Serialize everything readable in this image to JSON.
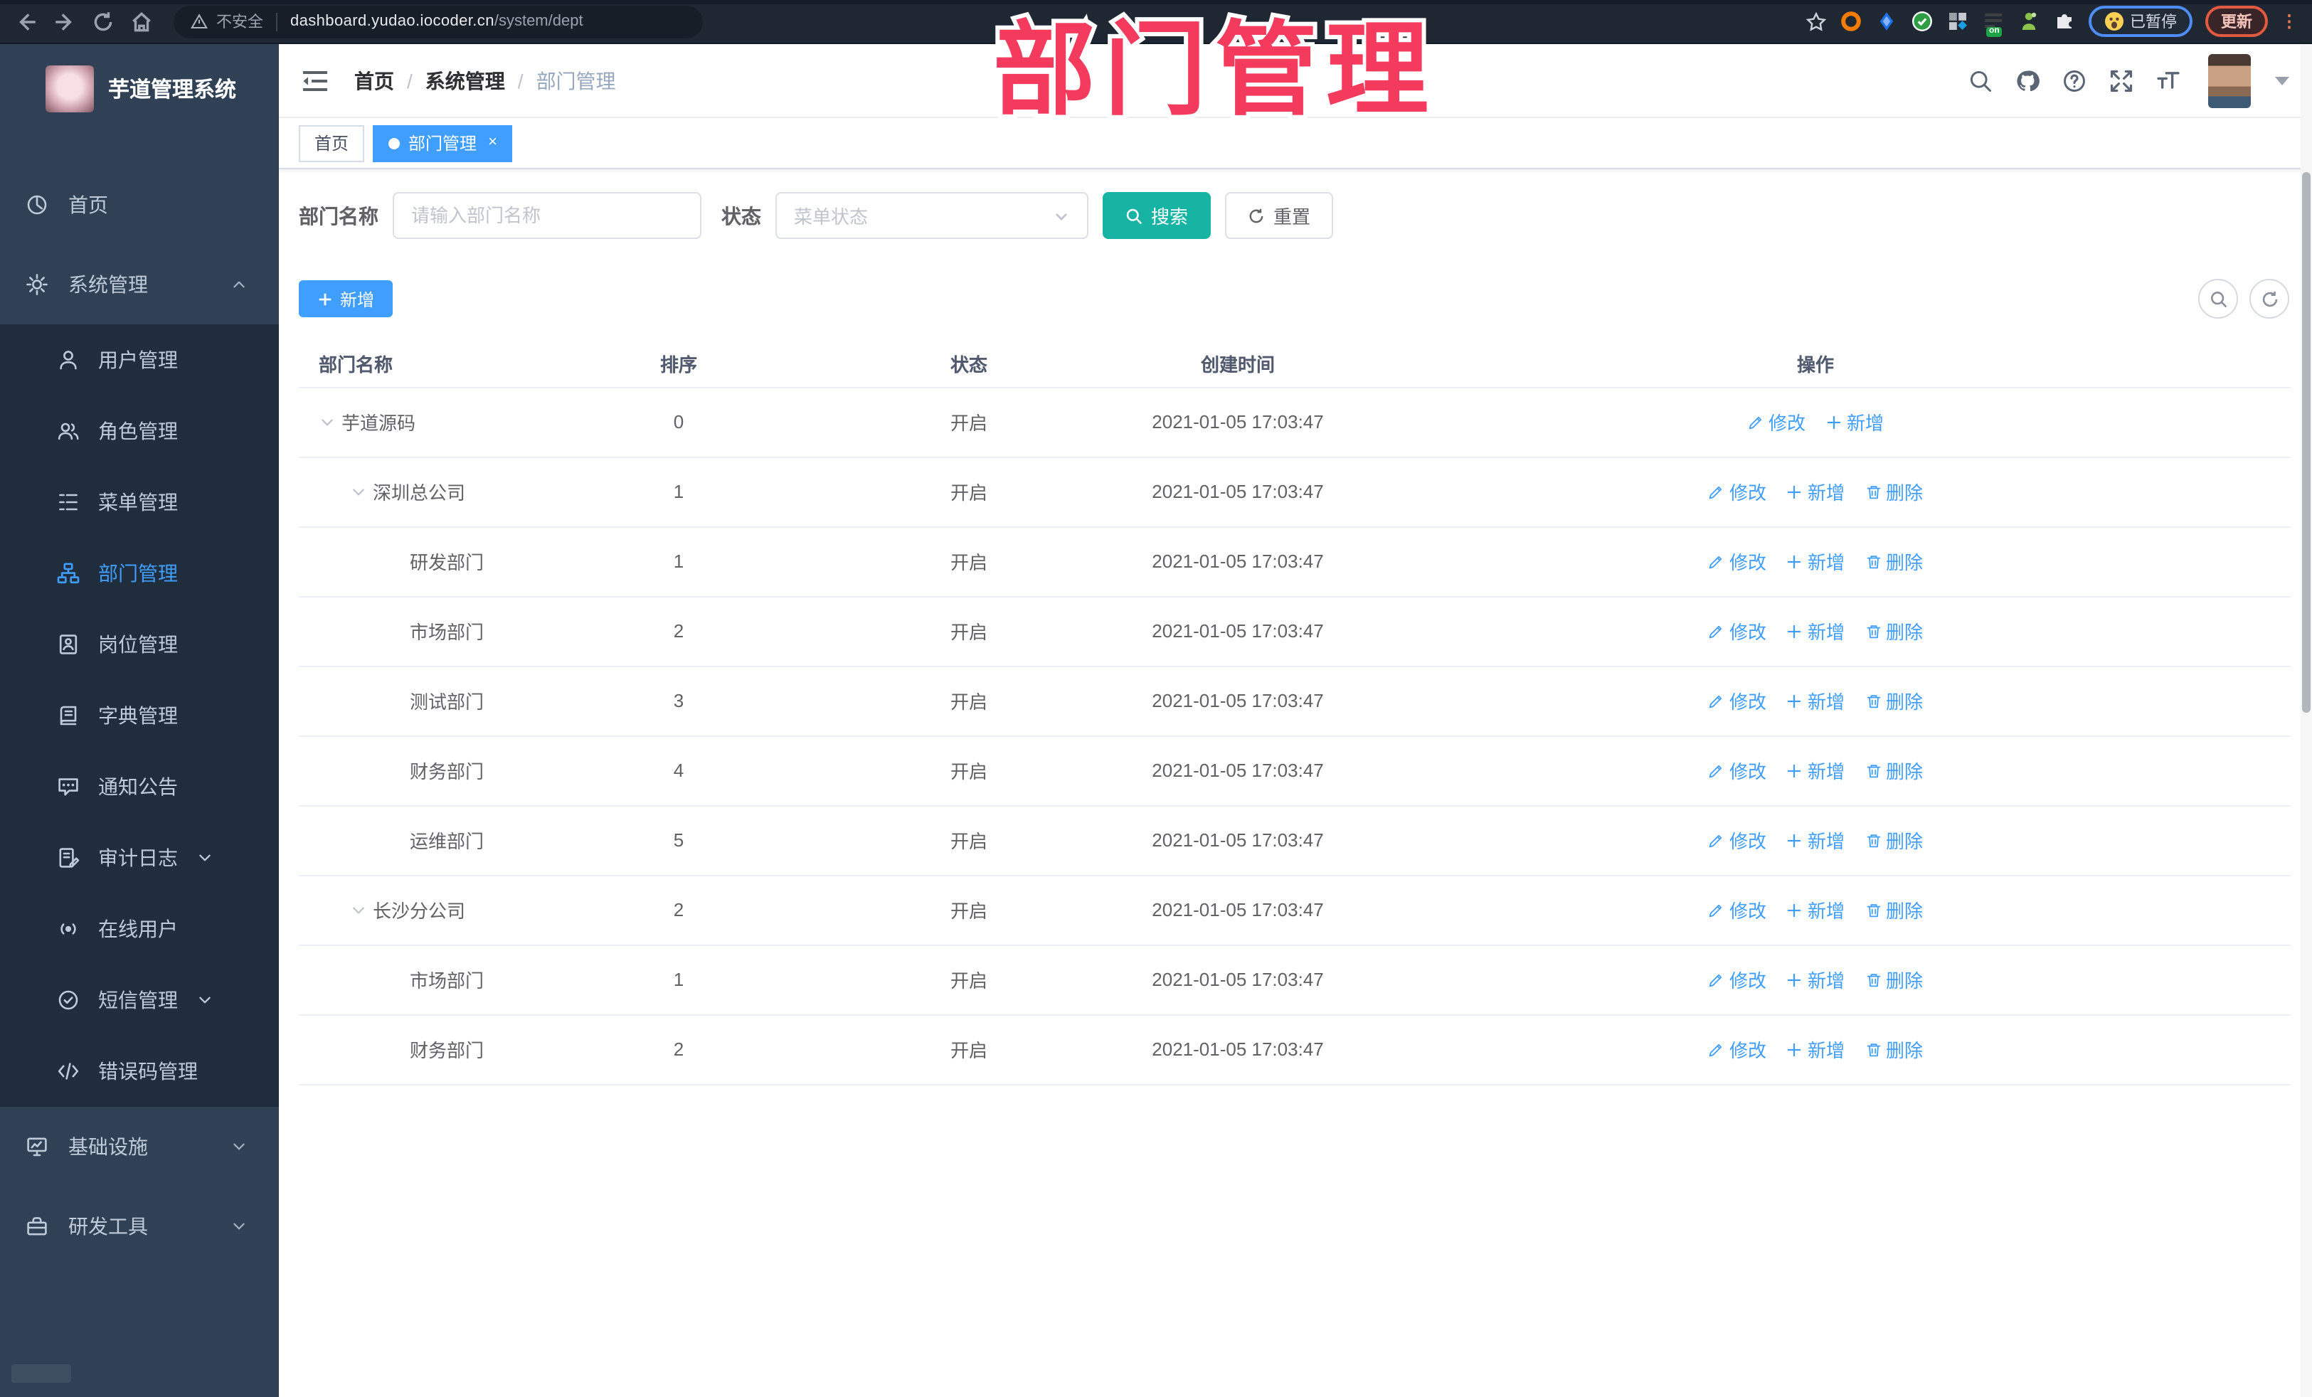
{
  "watermark": "部门管理",
  "colors": {
    "accent": "#409eff",
    "search_button": "#17b3a3",
    "watermark": "#f43b5e",
    "sidebar_bg": "#304156",
    "submenu_bg": "#1f2d3d",
    "active_tab": "#409eff"
  },
  "browser": {
    "security_label": "不安全",
    "url_host": "dashboard.yudao.iocoder.cn",
    "url_path": "/system/dept",
    "paused_label": "已暂停",
    "update_label": "更新",
    "extension_on_badge": "on",
    "extensions": [
      "orange-ring-extension-icon",
      "blue-drop-extension-icon",
      "green-check-extension-icon",
      "grid-extension-icon",
      "list-on-extension-icon",
      "green-person-extension-icon",
      "puzzle-extension-icon"
    ]
  },
  "sidebar": {
    "app_title": "芋道管理系统",
    "items": [
      {
        "id": "home",
        "label": "首页",
        "icon": "dashboard-icon",
        "level": "top"
      },
      {
        "id": "system",
        "label": "系统管理",
        "icon": "gear-icon",
        "level": "top",
        "arrow": "up"
      },
      {
        "id": "user",
        "label": "用户管理",
        "icon": "user-icon",
        "level": "sub"
      },
      {
        "id": "role",
        "label": "角色管理",
        "icon": "users-icon",
        "level": "sub"
      },
      {
        "id": "menu",
        "label": "菜单管理",
        "icon": "menu-tree-icon",
        "level": "sub"
      },
      {
        "id": "dept",
        "label": "部门管理",
        "icon": "org-icon",
        "level": "sub",
        "active": true
      },
      {
        "id": "post",
        "label": "岗位管理",
        "icon": "badge-icon",
        "level": "sub"
      },
      {
        "id": "dict",
        "label": "字典管理",
        "icon": "book-icon",
        "level": "sub"
      },
      {
        "id": "notice",
        "label": "通知公告",
        "icon": "chat-icon",
        "level": "sub"
      },
      {
        "id": "audit-log",
        "label": "审计日志",
        "icon": "log-icon",
        "level": "sub",
        "arrow": "down"
      },
      {
        "id": "online-user",
        "label": "在线用户",
        "icon": "online-icon",
        "level": "sub"
      },
      {
        "id": "sms",
        "label": "短信管理",
        "icon": "check-circle-icon",
        "level": "sub",
        "arrow": "down"
      },
      {
        "id": "error-code",
        "label": "错误码管理",
        "icon": "code-icon",
        "level": "sub"
      },
      {
        "id": "infra",
        "label": "基础设施",
        "icon": "monitor-icon",
        "level": "top",
        "arrow": "down"
      },
      {
        "id": "dev-tools",
        "label": "研发工具",
        "icon": "toolbox-icon",
        "level": "top",
        "arrow": "down"
      }
    ]
  },
  "header": {
    "breadcrumb": [
      "首页",
      "系统管理",
      "部门管理"
    ],
    "icons": [
      "search-icon",
      "github-icon",
      "question-icon",
      "fullscreen-icon",
      "font-size-icon"
    ]
  },
  "tabs": [
    {
      "label": "首页",
      "active": false,
      "closable": false
    },
    {
      "label": "部门管理",
      "active": true,
      "closable": true
    }
  ],
  "filters": {
    "name_label": "部门名称",
    "name_placeholder": "请输入部门名称",
    "name_value": "",
    "status_label": "状态",
    "status_placeholder": "菜单状态",
    "search_label": "搜索",
    "reset_label": "重置"
  },
  "toolbar": {
    "add_label": "新增"
  },
  "table": {
    "columns": [
      "部门名称",
      "排序",
      "状态",
      "创建时间",
      "操作"
    ],
    "action_labels": {
      "edit": "修改",
      "add": "新增",
      "delete": "删除"
    },
    "rows": [
      {
        "name": "芋道源码",
        "level": 0,
        "expandable": true,
        "sort": "0",
        "status": "开启",
        "created": "2021-01-05 17:03:47",
        "actions": [
          "edit",
          "add"
        ]
      },
      {
        "name": "深圳总公司",
        "level": 1,
        "expandable": true,
        "sort": "1",
        "status": "开启",
        "created": "2021-01-05 17:03:47",
        "actions": [
          "edit",
          "add",
          "delete"
        ]
      },
      {
        "name": "研发部门",
        "level": 2,
        "expandable": false,
        "sort": "1",
        "status": "开启",
        "created": "2021-01-05 17:03:47",
        "actions": [
          "edit",
          "add",
          "delete"
        ]
      },
      {
        "name": "市场部门",
        "level": 2,
        "expandable": false,
        "sort": "2",
        "status": "开启",
        "created": "2021-01-05 17:03:47",
        "actions": [
          "edit",
          "add",
          "delete"
        ]
      },
      {
        "name": "测试部门",
        "level": 2,
        "expandable": false,
        "sort": "3",
        "status": "开启",
        "created": "2021-01-05 17:03:47",
        "actions": [
          "edit",
          "add",
          "delete"
        ]
      },
      {
        "name": "财务部门",
        "level": 2,
        "expandable": false,
        "sort": "4",
        "status": "开启",
        "created": "2021-01-05 17:03:47",
        "actions": [
          "edit",
          "add",
          "delete"
        ]
      },
      {
        "name": "运维部门",
        "level": 2,
        "expandable": false,
        "sort": "5",
        "status": "开启",
        "created": "2021-01-05 17:03:47",
        "actions": [
          "edit",
          "add",
          "delete"
        ]
      },
      {
        "name": "长沙分公司",
        "level": 1,
        "expandable": true,
        "sort": "2",
        "status": "开启",
        "created": "2021-01-05 17:03:47",
        "actions": [
          "edit",
          "add",
          "delete"
        ]
      },
      {
        "name": "市场部门",
        "level": 2,
        "expandable": false,
        "sort": "1",
        "status": "开启",
        "created": "2021-01-05 17:03:47",
        "actions": [
          "edit",
          "add",
          "delete"
        ]
      },
      {
        "name": "财务部门",
        "level": 2,
        "expandable": false,
        "sort": "2",
        "status": "开启",
        "created": "2021-01-05 17:03:47",
        "actions": [
          "edit",
          "add",
          "delete"
        ]
      }
    ]
  }
}
